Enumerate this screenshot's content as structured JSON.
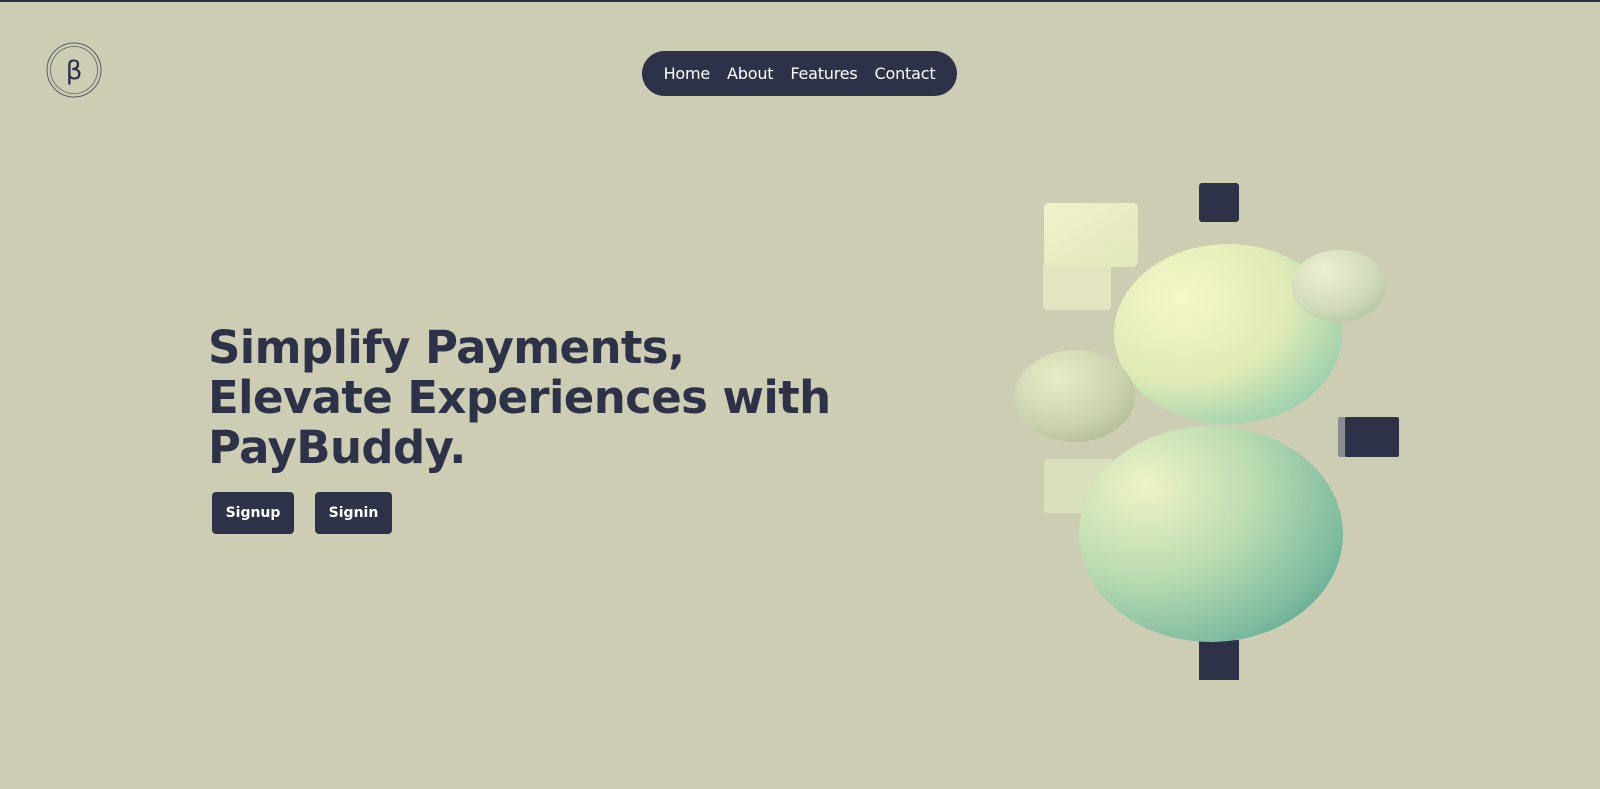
{
  "brand": {
    "logo_icon": "paybuddy-logo-icon",
    "logo_letter": "β"
  },
  "nav": {
    "items": [
      {
        "label": "Home"
      },
      {
        "label": "About"
      },
      {
        "label": "Features"
      },
      {
        "label": "Contact"
      }
    ]
  },
  "hero": {
    "title_lines": [
      "Simplify Payments,",
      "Elevate Experiences with",
      "PayBuddy."
    ],
    "signup_label": "Signup",
    "signin_label": "Signin",
    "illustration": "abstract-3d-spheres-illustration"
  },
  "colors": {
    "background": "#cdcdb4",
    "primary": "#2e3249",
    "accent_light": "#eef0c2",
    "accent_teal": "#4f9f8e"
  }
}
